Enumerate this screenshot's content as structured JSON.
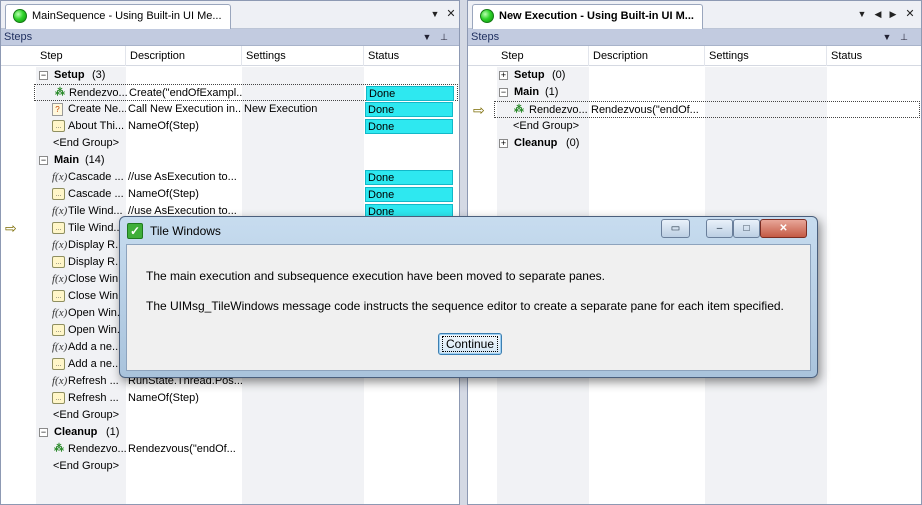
{
  "left": {
    "tab_title": "MainSequence - Using Built-in UI Me...",
    "panel_title": "Steps",
    "columns": [
      "Step",
      "Description",
      "Settings",
      "Status"
    ],
    "rows": [
      {
        "kind": "group",
        "expander": "−",
        "name": "Setup",
        "count": "(3)"
      },
      {
        "kind": "step",
        "icon": "rendezvous-icon",
        "glyph": "⁂",
        "step": "Rendezvo...",
        "desc": "Create(\"endOfExampl...",
        "settings": "",
        "status": "Done",
        "selected": true
      },
      {
        "kind": "step",
        "icon": "sequence-call-icon",
        "glyph": "?",
        "step": "Create Ne...",
        "desc": "Call New Execution in...",
        "settings": "New Execution",
        "status": "Done"
      },
      {
        "kind": "step",
        "icon": "message-icon",
        "glyph": "...",
        "step": "About Thi...",
        "desc": "NameOf(Step)",
        "settings": "",
        "status": "Done"
      },
      {
        "kind": "end",
        "step": "<End Group>"
      },
      {
        "kind": "group",
        "expander": "−",
        "name": "Main",
        "count": "(14)"
      },
      {
        "kind": "step",
        "icon": "expression-icon",
        "glyph": "f(x)",
        "step": "Cascade ...",
        "desc": "//use AsExecution to...",
        "settings": "",
        "status": "Done"
      },
      {
        "kind": "step",
        "icon": "message-icon",
        "glyph": "...",
        "step": "Cascade ...",
        "desc": "NameOf(Step)",
        "settings": "",
        "status": "Done"
      },
      {
        "kind": "step",
        "icon": "expression-icon",
        "glyph": "f(x)",
        "step": "Tile Wind...",
        "desc": "//use AsExecution to...",
        "settings": "",
        "status": "Done"
      },
      {
        "kind": "step",
        "icon": "message-icon",
        "glyph": "...",
        "step": "Tile Wind...",
        "desc": "",
        "settings": "",
        "status": "",
        "current": true
      },
      {
        "kind": "step",
        "icon": "expression-icon",
        "glyph": "f(x)",
        "step": "Display R...",
        "desc": "",
        "settings": "",
        "status": ""
      },
      {
        "kind": "step",
        "icon": "message-icon",
        "glyph": "...",
        "step": "Display R...",
        "desc": "",
        "settings": "",
        "status": ""
      },
      {
        "kind": "step",
        "icon": "expression-icon",
        "glyph": "f(x)",
        "step": "Close Win...",
        "desc": "",
        "settings": "",
        "status": ""
      },
      {
        "kind": "step",
        "icon": "message-icon",
        "glyph": "...",
        "step": "Close Win...",
        "desc": "",
        "settings": "",
        "status": ""
      },
      {
        "kind": "step",
        "icon": "expression-icon",
        "glyph": "f(x)",
        "step": "Open Win...",
        "desc": "",
        "settings": "",
        "status": ""
      },
      {
        "kind": "step",
        "icon": "message-icon",
        "glyph": "...",
        "step": "Open Win...",
        "desc": "",
        "settings": "",
        "status": ""
      },
      {
        "kind": "step",
        "icon": "expression-icon",
        "glyph": "f(x)",
        "step": "Add a ne...",
        "desc": "",
        "settings": "",
        "status": ""
      },
      {
        "kind": "step",
        "icon": "message-icon",
        "glyph": "...",
        "step": "Add a ne...",
        "desc": "",
        "settings": "",
        "status": ""
      },
      {
        "kind": "step",
        "icon": "expression-icon",
        "glyph": "f(x)",
        "step": "Refresh ...",
        "desc": "RunState.Thread.Pos...",
        "settings": "",
        "status": ""
      },
      {
        "kind": "step",
        "icon": "message-icon",
        "glyph": "...",
        "step": "Refresh ...",
        "desc": "NameOf(Step)",
        "settings": "",
        "status": ""
      },
      {
        "kind": "end",
        "step": "<End Group>"
      },
      {
        "kind": "group",
        "expander": "−",
        "name": "Cleanup",
        "count": "(1)"
      },
      {
        "kind": "step",
        "icon": "rendezvous-icon",
        "glyph": "⁂",
        "step": "Rendezvo...",
        "desc": "Rendezvous(\"endOf...",
        "settings": "",
        "status": ""
      },
      {
        "kind": "end",
        "step": "<End Group>"
      }
    ]
  },
  "right": {
    "tab_title": "New Execution - Using Built-in UI M...",
    "panel_title": "Steps",
    "columns": [
      "Step",
      "Description",
      "Settings",
      "Status"
    ],
    "rows": [
      {
        "kind": "group",
        "expander": "+",
        "name": "Setup",
        "count": "(0)"
      },
      {
        "kind": "group",
        "expander": "−",
        "name": "Main",
        "count": "(1)"
      },
      {
        "kind": "step",
        "icon": "rendezvous-icon",
        "glyph": "⁂",
        "step": "Rendezvo...",
        "desc": "Rendezvous(\"endOf...",
        "settings": "",
        "status": "",
        "selected": true,
        "current": true
      },
      {
        "kind": "end",
        "step": "<End Group>"
      },
      {
        "kind": "group",
        "expander": "+",
        "name": "Cleanup",
        "count": "(0)"
      }
    ]
  },
  "dialog": {
    "title": "Tile Windows",
    "message_1": "The main execution and subsequence execution have been moved to separate panes.",
    "message_2": "The UIMsg_TileWindows message code instructs the sequence editor to create a separate pane for each item specified.",
    "button_label": "Continue"
  }
}
